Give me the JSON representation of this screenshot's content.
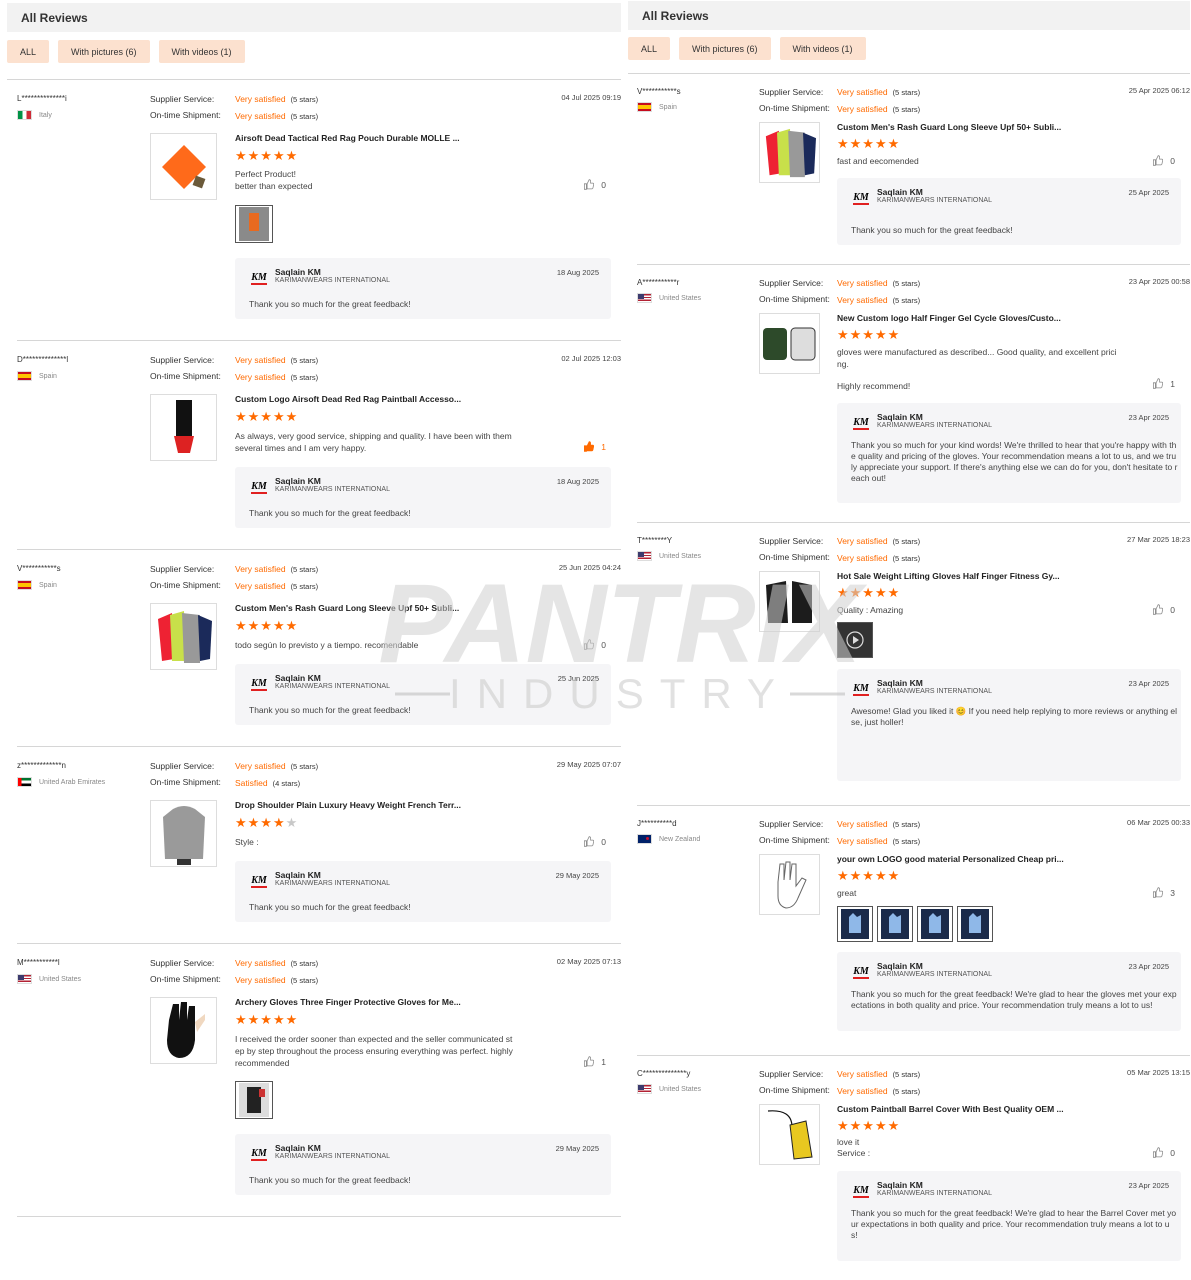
{
  "colors": {
    "accent": "#ff6a00",
    "filter_bg": "#fce1cf",
    "reply_bg": "#f5f5f7"
  },
  "left": {
    "header": "All Reviews",
    "filters": [
      "ALL",
      "With pictures (6)",
      "With videos (1)"
    ],
    "reviews": [
      {
        "name": "L**************i",
        "country": "Italy",
        "service_label": "Supplier Service:",
        "shipment_label": "On-time Shipment:",
        "service_rating": "Very satisfied",
        "service_stars": "(5 stars)",
        "shipment_rating": "Very satisfied",
        "shipment_stars": "(5 stars)",
        "date": "04 Jul 2025 09:19",
        "product": "Airsoft Dead Tactical Red Rag Pouch Durable MOLLE ...",
        "stars": 5,
        "text1": "Perfect Product!",
        "text2": "better than expected",
        "likes": "0",
        "reply_name": "Saqlain KM",
        "reply_company": "KARIMANWEARS INTERNATIONAL",
        "reply_date": "18 Aug 2025",
        "reply_text": "Thank you so much for the great feedback!"
      },
      {
        "name": "D**************l",
        "country": "Spain",
        "service_label": "Supplier Service:",
        "shipment_label": "On-time Shipment:",
        "service_rating": "Very satisfied",
        "service_stars": "(5 stars)",
        "shipment_rating": "Very satisfied",
        "shipment_stars": "(5 stars)",
        "date": "02 Jul 2025 12:03",
        "product": "Custom Logo Airsoft Dead Red Rag Paintball Accesso...",
        "stars": 5,
        "text1": "As always, very good service, shipping and quality. I have been with them",
        "text2": "several times and I am very happy.",
        "likes": "1",
        "reply_name": "Saqlain KM",
        "reply_company": "KARIMANWEARS INTERNATIONAL",
        "reply_date": "18 Aug 2025",
        "reply_text": "Thank you so much for the great feedback!"
      },
      {
        "name": "V***********s",
        "country": "Spain",
        "service_label": "Supplier Service:",
        "shipment_label": "On-time Shipment:",
        "service_rating": "Very satisfied",
        "service_stars": "(5 stars)",
        "shipment_rating": "Very satisfied",
        "shipment_stars": "(5 stars)",
        "date": "25 Jun 2025 04:24",
        "product": "Custom Men's Rash Guard Long Sleeve Upf 50+ Subli...",
        "stars": 5,
        "text1": "todo según lo previsto y a tiempo. recomendable",
        "likes": "0",
        "reply_name": "Saqlain KM",
        "reply_company": "KARIMANWEARS INTERNATIONAL",
        "reply_date": "25 Jun 2025",
        "reply_text": "Thank you so much for the great feedback!"
      },
      {
        "name": "z*************n",
        "country": "United Arab Emirates",
        "service_label": "Supplier Service:",
        "shipment_label": "On-time Shipment:",
        "service_rating": "Very satisfied",
        "service_stars": "(5 stars)",
        "shipment_rating": "Satisfied",
        "shipment_stars": "(4 stars)",
        "date": "29 May 2025 07:07",
        "product": "Drop Shoulder Plain Luxury Heavy Weight French Terr...",
        "stars": 4,
        "text1": "Style :",
        "likes": "0",
        "reply_name": "Saqlain KM",
        "reply_company": "KARIMANWEARS INTERNATIONAL",
        "reply_date": "29 May 2025",
        "reply_text": "Thank you so much for the great feedback!"
      },
      {
        "name": "M***********l",
        "country": "United States",
        "service_label": "Supplier Service:",
        "shipment_label": "On-time Shipment:",
        "service_rating": "Very satisfied",
        "service_stars": "(5 stars)",
        "shipment_rating": "Very satisfied",
        "shipment_stars": "(5 stars)",
        "date": "02 May 2025 07:13",
        "product": "Archery Gloves Three Finger Protective Gloves for Me...",
        "stars": 5,
        "text1": "I received the order sooner than expected and the seller communicated st",
        "text2": "ep by step throughout the process ensuring everything was perfect. highly",
        "text3": "recommended",
        "likes": "1",
        "reply_name": "Saqlain KM",
        "reply_company": "KARIMANWEARS INTERNATIONAL",
        "reply_date": "29 May 2025",
        "reply_text": "Thank you so much for the great feedback!"
      }
    ]
  },
  "right": {
    "header": "All Reviews",
    "filters": [
      "ALL",
      "With pictures (6)",
      "With videos (1)"
    ],
    "reviews": [
      {
        "name": "V***********s",
        "country": "Spain",
        "service_label": "Supplier Service:",
        "shipment_label": "On-time Shipment:",
        "service_rating": "Very satisfied",
        "service_stars": "(5 stars)",
        "shipment_rating": "Very satisfied",
        "shipment_stars": "(5 stars)",
        "date": "25 Apr 2025 06:12",
        "product": "Custom Men's Rash Guard Long Sleeve Upf 50+ Subli...",
        "stars": 5,
        "text1": "fast and eecomended",
        "likes": "0",
        "reply_name": "Saqlain KM",
        "reply_company": "KARIMANWEARS INTERNATIONAL",
        "reply_date": "25 Apr 2025",
        "reply_text1": "Thank you so much for the great feedback!"
      },
      {
        "name": "A***********r",
        "country": "United States",
        "service_label": "Supplier Service:",
        "shipment_label": "On-time Shipment:",
        "service_rating": "Very satisfied",
        "service_stars": "(5 stars)",
        "shipment_rating": "Very satisfied",
        "shipment_stars": "(5 stars)",
        "date": "23 Apr 2025 00:58",
        "product": "New Custom logo Half Finger Gel Cycle Gloves/Custo...",
        "stars": 5,
        "text1": "gloves were manufactured as described... Good quality, and excellent prici",
        "text2": "ng.",
        "text3": "Highly recommend!",
        "likes": "1",
        "reply_name": "Saqlain KM",
        "reply_company": "KARIMANWEARS INTERNATIONAL",
        "reply_date": "23 Apr 2025",
        "reply_text1": "Thank you so much for your kind words! We're thrilled to hear that you're happy with th",
        "reply_text2": "e quality and pricing of the gloves. Your recommendation means a lot to us, and we tru",
        "reply_text3": "ly appreciate your support. If there's anything else we can do for you, don't hesitate to r",
        "reply_text4": "each out!"
      },
      {
        "name": "T********Y",
        "country": "United States",
        "service_label": "Supplier Service:",
        "shipment_label": "On-time Shipment:",
        "service_rating": "Very satisfied",
        "service_stars": "(5 stars)",
        "shipment_rating": "Very satisfied",
        "shipment_stars": "(5 stars)",
        "date": "27 Mar 2025 18:23",
        "product": "Hot Sale Weight Lifting Gloves Half Finger Fitness Gy...",
        "stars": 5,
        "text1": "Quality : Amazing",
        "likes": "0",
        "reply_name": "Saqlain KM",
        "reply_company": "KARIMANWEARS INTERNATIONAL",
        "reply_date": "23 Apr 2025",
        "reply_text1": "Awesome! Glad you liked it 😊 If you need help replying to more reviews or anything el",
        "reply_text2": "se, just holler!"
      },
      {
        "name": "J**********d",
        "country": "New Zealand",
        "service_label": "Supplier Service:",
        "shipment_label": "On-time Shipment:",
        "service_rating": "Very satisfied",
        "service_stars": "(5 stars)",
        "shipment_rating": "Very satisfied",
        "shipment_stars": "(5 stars)",
        "date": "06 Mar 2025 00:33",
        "product": "your own LOGO good material Personalized Cheap pri...",
        "stars": 5,
        "text1": "great",
        "likes": "3",
        "reply_name": "Saqlain KM",
        "reply_company": "KARIMANWEARS INTERNATIONAL",
        "reply_date": "23 Apr 2025",
        "reply_text1": "Thank you so much for the great feedback! We're glad to hear the gloves met your exp",
        "reply_text2": "ectations in both quality and price. Your recommendation truly means a lot to us!"
      },
      {
        "name": "C**************y",
        "country": "United States",
        "service_label": "Supplier Service:",
        "shipment_label": "On-time Shipment:",
        "service_rating": "Very satisfied",
        "service_stars": "(5 stars)",
        "shipment_rating": "Very satisfied",
        "shipment_stars": "(5 stars)",
        "date": "05 Mar 2025 13:15",
        "product": "Custom Paintball Barrel Cover With Best Quality OEM ...",
        "stars": 5,
        "text1": "love it",
        "text2": "Service :",
        "likes": "0",
        "reply_name": "Saqlain KM",
        "reply_company": "KARIMANWEARS INTERNATIONAL",
        "reply_date": "23 Apr 2025",
        "reply_text1": "Thank you so much for the great feedback! We're glad to hear the Barrel Cover met yo",
        "reply_text2": "ur expectations in both quality and price. Your recommendation truly means a lot to u",
        "reply_text3": "s!"
      }
    ]
  },
  "watermark": {
    "line1": "PANTRIX",
    "line2": "INDUSTRY"
  },
  "logo_text": "KM"
}
